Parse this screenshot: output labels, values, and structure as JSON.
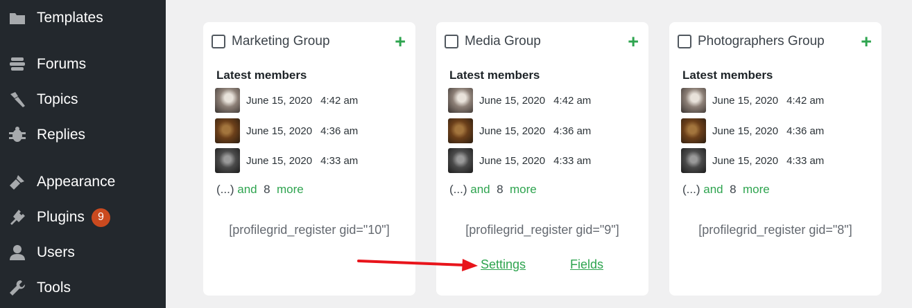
{
  "sidebar": {
    "items": [
      {
        "label": "Templates",
        "icon": "folder-icon"
      },
      {
        "label": "Forums",
        "icon": "forums-icon"
      },
      {
        "label": "Topics",
        "icon": "topics-icon"
      },
      {
        "label": "Replies",
        "icon": "replies-icon"
      },
      {
        "label": "Appearance",
        "icon": "paintbrush-icon"
      },
      {
        "label": "Plugins",
        "icon": "plugin-icon",
        "badge": "9"
      },
      {
        "label": "Users",
        "icon": "user-icon"
      },
      {
        "label": "Tools",
        "icon": "wrench-icon"
      }
    ]
  },
  "groups": [
    {
      "name": "Marketing Group",
      "latest_label": "Latest members",
      "members": [
        {
          "date": "June 15, 2020",
          "time": "4:42 am"
        },
        {
          "date": "June 15, 2020",
          "time": "4:36 am"
        },
        {
          "date": "June 15, 2020",
          "time": "4:33 am"
        }
      ],
      "more_prefix": "(...)",
      "more_and": "and",
      "more_count": "8",
      "more_suffix": "more",
      "shortcode": "[profilegrid_register gid=\"10\"]"
    },
    {
      "name": "Media Group",
      "latest_label": "Latest members",
      "members": [
        {
          "date": "June 15, 2020",
          "time": "4:42 am"
        },
        {
          "date": "June 15, 2020",
          "time": "4:36 am"
        },
        {
          "date": "June 15, 2020",
          "time": "4:33 am"
        }
      ],
      "more_prefix": "(...)",
      "more_and": "and",
      "more_count": "8",
      "more_suffix": "more",
      "shortcode": "[profilegrid_register gid=\"9\"]",
      "settings_label": "Settings",
      "fields_label": "Fields"
    },
    {
      "name": "Photographers Group",
      "latest_label": "Latest members",
      "members": [
        {
          "date": "June 15, 2020",
          "time": "4:42 am"
        },
        {
          "date": "June 15, 2020",
          "time": "4:36 am"
        },
        {
          "date": "June 15, 2020",
          "time": "4:33 am"
        }
      ],
      "more_prefix": "(...)",
      "more_and": "and",
      "more_count": "8",
      "more_suffix": "more",
      "shortcode": "[profilegrid_register gid=\"8\"]"
    }
  ],
  "colors": {
    "sidebar_bg": "#23282d",
    "accent_green": "#2ea44f",
    "badge": "#ca4a1f",
    "annotation_arrow": "#e8141b"
  }
}
